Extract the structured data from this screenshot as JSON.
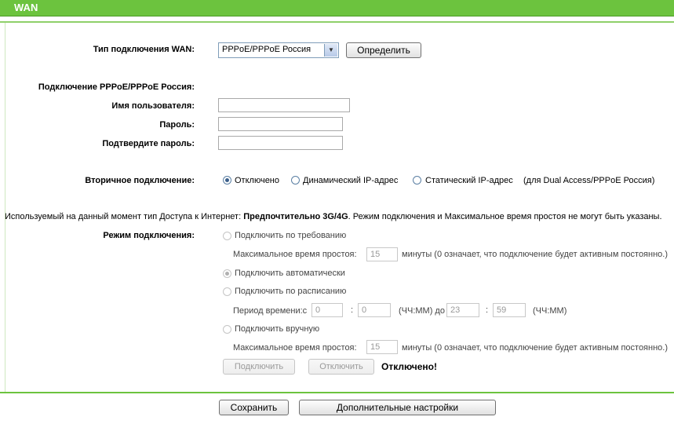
{
  "header": {
    "title": "WAN"
  },
  "wan_type": {
    "label": "Тип подключения WAN:",
    "selected": "PPPoE/PPPoE Россия",
    "detect_button": "Определить"
  },
  "pppoe": {
    "section_title": "Подключение PPPoE/PPPoE Россия:",
    "username_label": "Имя пользователя:",
    "username_value": "",
    "password_label": "Пароль:",
    "password_value": "",
    "confirm_label": "Подтвердите пароль:",
    "confirm_value": ""
  },
  "secondary": {
    "label": "Вторичное подключение:",
    "options": [
      "Отключено",
      "Динамический IP-адрес",
      "Статический IP-адрес"
    ],
    "selected": "Отключено",
    "note": "(для Dual Access/PPPoE Россия)"
  },
  "info": {
    "prefix": "Используемый на данный момент тип Доступа к Интернет:",
    "bold": "Предпочтительно 3G/4G",
    "suffix": ". Режим подключения и Максимальное время простоя не могут быть указаны."
  },
  "mode": {
    "label": "Режим подключения:",
    "on_demand": "Подключить по требованию",
    "idle_label": "Максимальное время простоя:",
    "idle_value": "15",
    "idle_note": "минуты (0 означает, что подключение будет активным постоянно.)",
    "auto": "Подключить автоматически",
    "schedule": "Подключить по расписанию",
    "period_label": "Период времени:с",
    "start_h": "0",
    "start_m": "0",
    "hhmm_to": "(ЧЧ:ММ) до",
    "end_h": "23",
    "end_m": "59",
    "hhmm": "(ЧЧ:ММ)",
    "manual": "Подключить вручную",
    "idle_label2": "Максимальное время простоя:",
    "idle_value2": "15",
    "idle_note2": "минуты (0 означает, что подключение будет активным постоянно.)",
    "colon": ":",
    "connect_button": "Подключить",
    "disconnect_button": "Отключить",
    "status": "Отключено!"
  },
  "footer": {
    "save_button": "Сохранить",
    "advanced_button": "Дополнительные настройки"
  }
}
